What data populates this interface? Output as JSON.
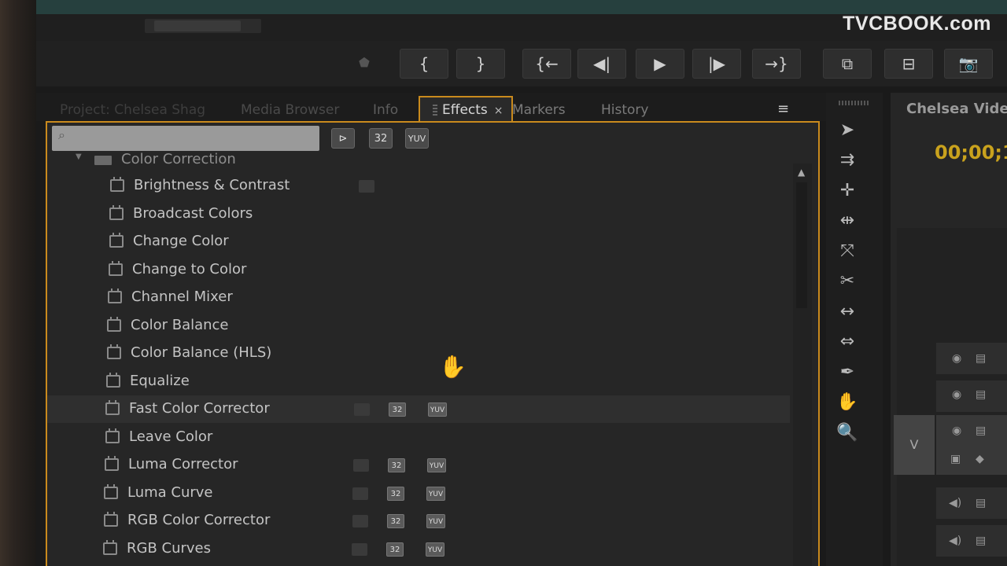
{
  "watermark": "TVCBOOK.com",
  "transport": {
    "buttons": [
      {
        "name": "mark-in-button",
        "glyph": "{"
      },
      {
        "name": "mark-out-button",
        "glyph": "}"
      },
      {
        "name": "go-to-in-button",
        "glyph": "{←"
      },
      {
        "name": "step-back-button",
        "glyph": "◀|"
      },
      {
        "name": "play-button",
        "glyph": "▶"
      },
      {
        "name": "step-forward-button",
        "glyph": "|▶"
      },
      {
        "name": "go-to-out-button",
        "glyph": "→}"
      },
      {
        "name": "insert-button",
        "glyph": "⧉"
      },
      {
        "name": "overwrite-button",
        "glyph": "⊟"
      },
      {
        "name": "export-frame-button",
        "glyph": "📷"
      }
    ]
  },
  "tabs": {
    "project": "Project: Chelsea Shag",
    "media_browser": "Media Browser",
    "info": "Info",
    "effects": "Effects",
    "markers": "Markers",
    "history": "History",
    "close": "×"
  },
  "panel_menu": "≡",
  "search": {
    "placeholder": "",
    "icon": "search-icon"
  },
  "filter_buttons": {
    "accelerated": "⊳",
    "bit32": "32",
    "yuv": "YUV"
  },
  "folder": {
    "label": "Color Correction",
    "disclosure": "▼"
  },
  "effects": [
    {
      "label": "Brightness & Contrast",
      "accel": true,
      "b32": false,
      "yuv": false
    },
    {
      "label": "Broadcast Colors",
      "accel": false,
      "b32": false,
      "yuv": false
    },
    {
      "label": "Change Color",
      "accel": false,
      "b32": false,
      "yuv": false
    },
    {
      "label": "Change to Color",
      "accel": false,
      "b32": false,
      "yuv": false
    },
    {
      "label": "Channel Mixer",
      "accel": false,
      "b32": false,
      "yuv": false
    },
    {
      "label": "Color Balance",
      "accel": false,
      "b32": false,
      "yuv": false
    },
    {
      "label": "Color Balance (HLS)",
      "accel": false,
      "b32": false,
      "yuv": false
    },
    {
      "label": "Equalize",
      "accel": false,
      "b32": false,
      "yuv": false
    },
    {
      "label": "Fast Color Corrector",
      "accel": true,
      "b32": true,
      "yuv": true,
      "selected": true
    },
    {
      "label": "Leave Color",
      "accel": false,
      "b32": false,
      "yuv": false
    },
    {
      "label": "Luma Corrector",
      "accel": true,
      "b32": true,
      "yuv": true
    },
    {
      "label": "Luma Curve",
      "accel": true,
      "b32": true,
      "yuv": true
    },
    {
      "label": "RGB Color Corrector",
      "accel": true,
      "b32": true,
      "yuv": true
    },
    {
      "label": "RGB Curves",
      "accel": true,
      "b32": true,
      "yuv": true
    }
  ],
  "badge_text": {
    "b32": "32",
    "yuv": "YUV"
  },
  "tools": [
    {
      "name": "selection-tool-icon",
      "glyph": "➤"
    },
    {
      "name": "track-select-tool-icon",
      "glyph": "⇉"
    },
    {
      "name": "ripple-edit-tool-icon",
      "glyph": "✛"
    },
    {
      "name": "rolling-edit-tool-icon",
      "glyph": "⇹"
    },
    {
      "name": "rate-stretch-tool-icon",
      "glyph": "⤧"
    },
    {
      "name": "razor-tool-icon",
      "glyph": "✂"
    },
    {
      "name": "slip-tool-icon",
      "glyph": "↔"
    },
    {
      "name": "slide-tool-icon",
      "glyph": "⇔"
    },
    {
      "name": "pen-tool-icon",
      "glyph": "✒"
    },
    {
      "name": "hand-tool-icon",
      "glyph": "✋"
    },
    {
      "name": "zoom-tool-icon",
      "glyph": "🔍"
    }
  ],
  "sequence": {
    "title": "Chelsea Video",
    "timecode": "00;00;1",
    "track_label": "V"
  },
  "cursor_glyph": "✋"
}
